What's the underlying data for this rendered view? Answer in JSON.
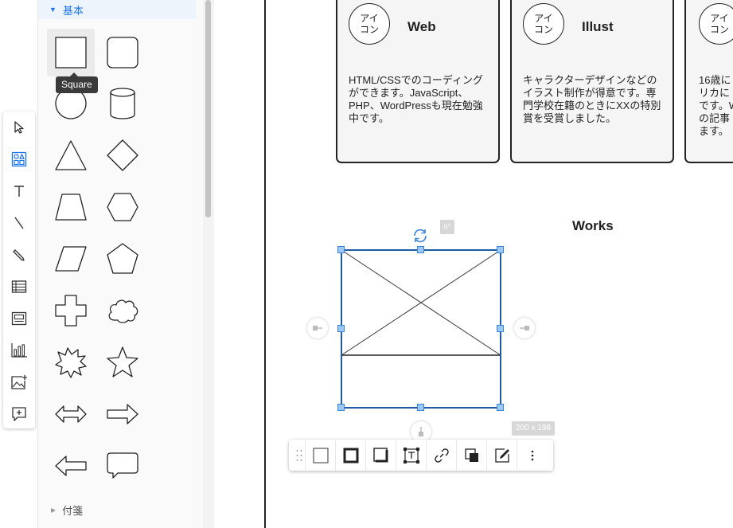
{
  "panel": {
    "section_basic": "基本",
    "section_sticky": "付箋",
    "tooltip": "Square"
  },
  "cards": [
    {
      "avatar": "アイ\nコン",
      "title": "Web",
      "desc": "HTML/CSSでのコーディングができます。JavaScript、PHP、WordPressも現在勉強中です。"
    },
    {
      "avatar": "アイ\nコン",
      "title": "Illust",
      "desc": "キャラクターデザインなどのイラスト制作が得意です。専門学校在籍のときにXXの特別賞を受賞しました。"
    },
    {
      "avatar": "アイ\nコン",
      "title": "",
      "desc": "16歳に\nリカに\nです。W\nの記事\nます。"
    }
  ],
  "canvas": {
    "works_title": "Works",
    "angle": "0°",
    "size": "200 x 198"
  },
  "colors": {
    "accent": "#1a73e8",
    "selection": "#1f5aa6",
    "handle_fill": "#9cc8f5"
  }
}
